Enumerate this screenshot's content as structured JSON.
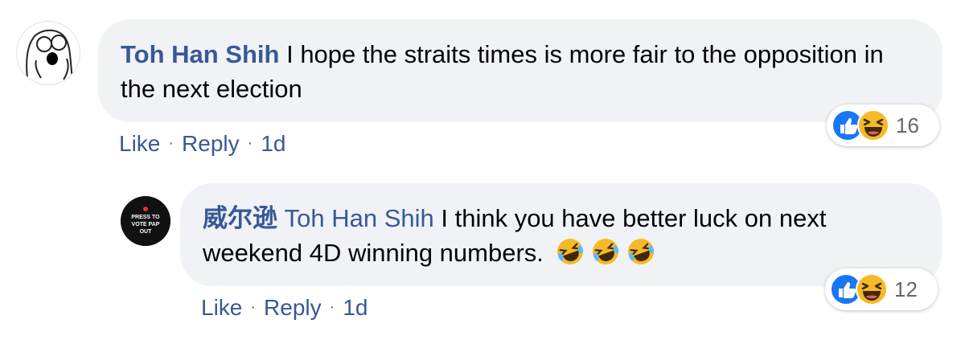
{
  "comments": [
    {
      "author": "Toh Han Shih",
      "text": "I hope the straits times is more fair to the opposition in the next election",
      "reaction_count": "16",
      "reactions": [
        "like-icon",
        "haha-icon"
      ],
      "actions": {
        "like": "Like",
        "reply": "Reply",
        "time": "1d"
      }
    },
    {
      "author": "威尔逊",
      "mention": "Toh Han Shih",
      "text": "I think you have better luck on next weekend 4D winning numbers.",
      "emojis": [
        "rolling-laughing-icon",
        "rolling-laughing-icon",
        "rolling-laughing-icon"
      ],
      "reaction_count": "12",
      "reactions": [
        "like-icon",
        "haha-icon"
      ],
      "actions": {
        "like": "Like",
        "reply": "Reply",
        "time": "1d"
      },
      "avatar_text": "PRESS TO VOTE PAP OUT"
    }
  ],
  "colors": {
    "link": "#385898",
    "bubble": "#f0f2f5",
    "like": "#1877f2",
    "haha": "#f7b928"
  }
}
